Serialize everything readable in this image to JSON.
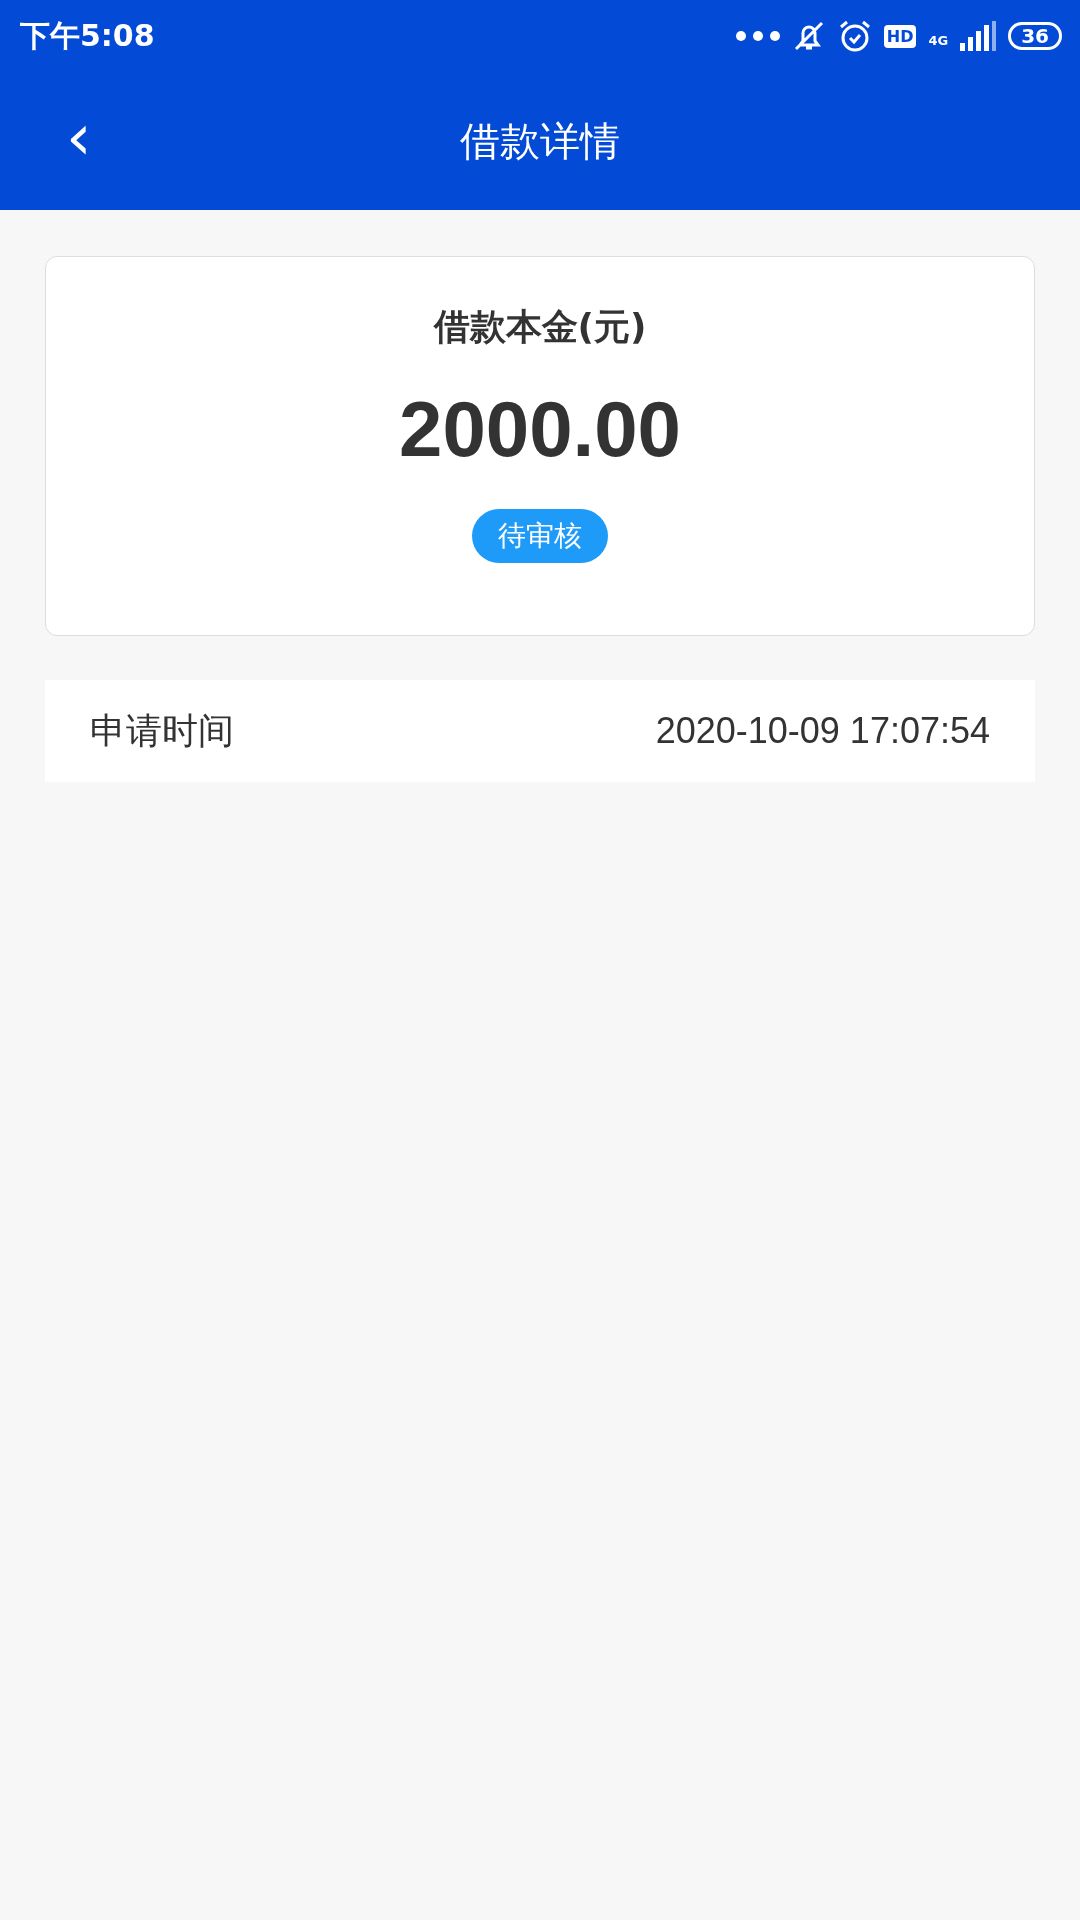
{
  "status_bar": {
    "time": "下午5:08",
    "hd": "HD",
    "network": "4G",
    "battery": "36"
  },
  "header": {
    "back": "‹",
    "title": "借款详情"
  },
  "summary": {
    "label": "借款本金(元)",
    "amount": "2000.00",
    "status": "待审核"
  },
  "details": [
    {
      "label": "申请时间",
      "value": "2020-10-09 17:07:54"
    }
  ]
}
